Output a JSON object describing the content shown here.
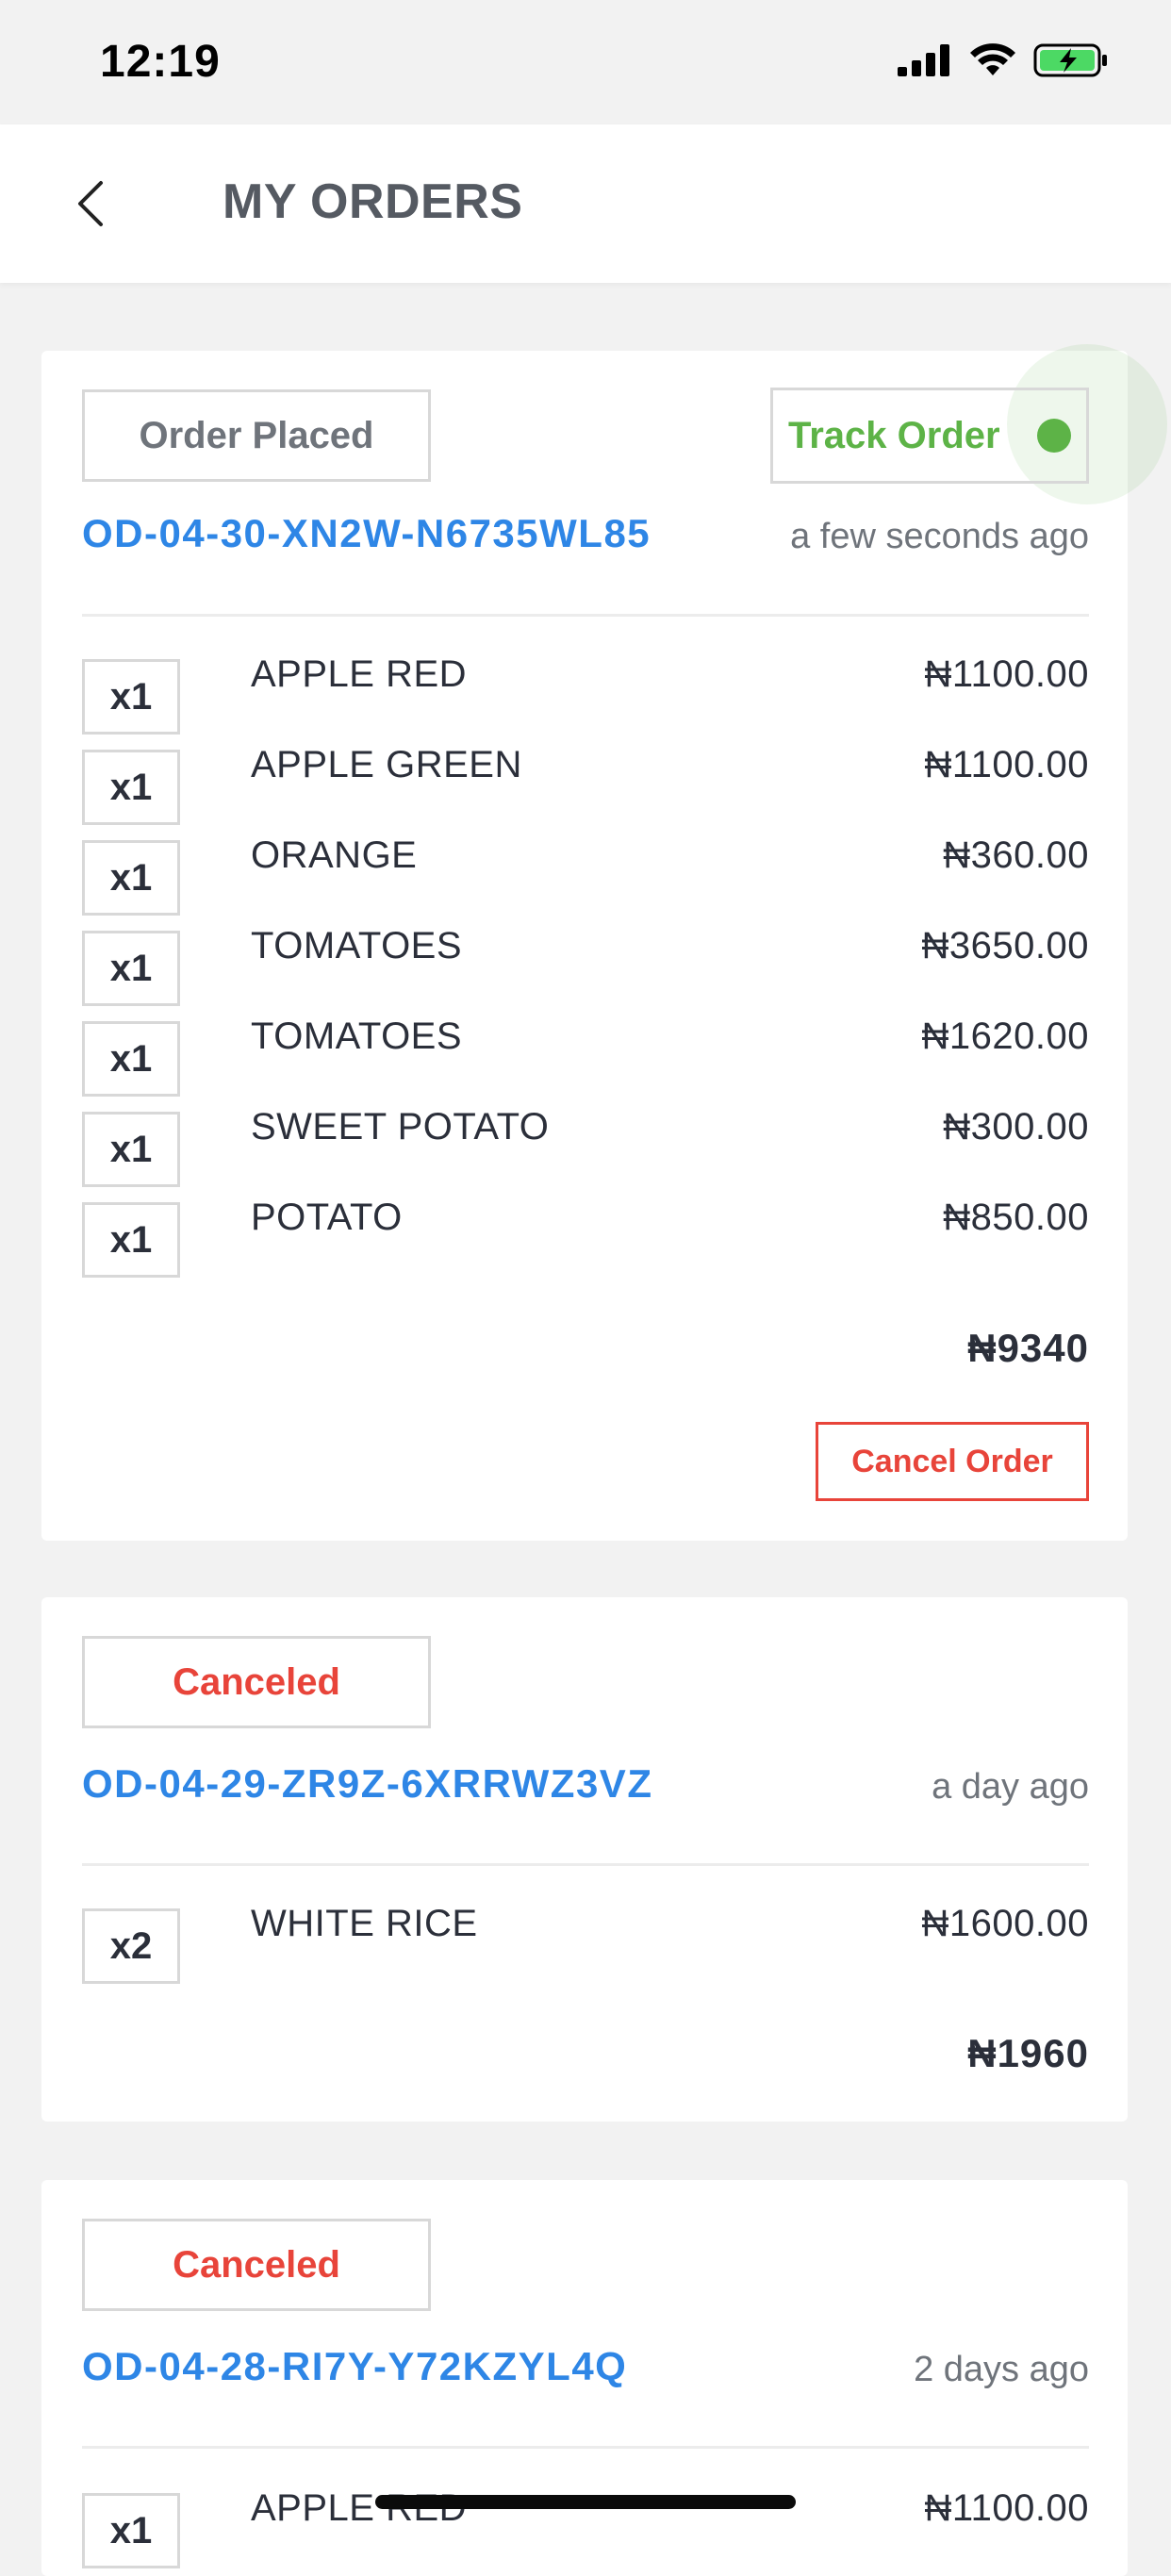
{
  "status_bar": {
    "time": "12:19"
  },
  "header": {
    "title": "MY ORDERS"
  },
  "orders": [
    {
      "status": "Order Placed",
      "track_label": "Track Order",
      "order_id": "OD-04-30-XN2W-N6735WL85",
      "time_ago": "a few seconds ago",
      "items": [
        {
          "qty": "x1",
          "name": "APPLE RED",
          "price": "₦1100.00"
        },
        {
          "qty": "x1",
          "name": "APPLE GREEN",
          "price": "₦1100.00"
        },
        {
          "qty": "x1",
          "name": "ORANGE",
          "price": "₦360.00"
        },
        {
          "qty": "x1",
          "name": "TOMATOES",
          "price": "₦3650.00"
        },
        {
          "qty": "x1",
          "name": "TOMATOES",
          "price": "₦1620.00"
        },
        {
          "qty": "x1",
          "name": "SWEET POTATO",
          "price": "₦300.00"
        },
        {
          "qty": "x1",
          "name": "POTATO",
          "price": "₦850.00"
        }
      ],
      "total": "₦9340",
      "cancel_label": "Cancel Order"
    },
    {
      "status": "Canceled",
      "order_id": "OD-04-29-ZR9Z-6XRRWZ3VZ",
      "time_ago": "a day ago",
      "items": [
        {
          "qty": "x2",
          "name": "WHITE RICE",
          "price": "₦1600.00"
        }
      ],
      "total": "₦1960"
    },
    {
      "status": "Canceled",
      "order_id": "OD-04-28-RI7Y-Y72KZYL4Q",
      "time_ago": "2 days ago",
      "items": [
        {
          "qty": "x1",
          "name": "APPLE RED",
          "price": "₦1100.00"
        }
      ]
    }
  ],
  "colors": {
    "accent_blue": "#2e86e6",
    "success_green": "#5db347",
    "danger_red": "#e8443a"
  }
}
